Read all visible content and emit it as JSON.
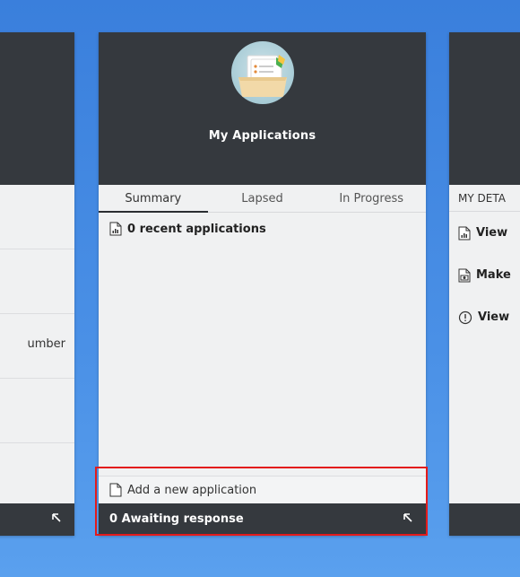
{
  "left_card": {
    "row_text": "umber"
  },
  "center_card": {
    "title": "My Applications",
    "tabs": [
      {
        "label": "Summary",
        "active": true
      },
      {
        "label": "Lapsed",
        "active": false
      },
      {
        "label": "In Progress",
        "active": false
      }
    ],
    "summary_text": "0 recent applications",
    "add_action": "Add a new application",
    "footer_status": "0 Awaiting response",
    "icons": {
      "logo": "application-folder-icon",
      "summary": "report-chart-icon",
      "add": "document-icon",
      "footer": "expand-arrow-icon"
    }
  },
  "right_card": {
    "heading": "MY DETA",
    "items": [
      {
        "label": "View",
        "icon": "report-chart-icon"
      },
      {
        "label": "Make",
        "icon": "document-camera-icon"
      },
      {
        "label": "View",
        "icon": "alert-circle-icon"
      }
    ]
  },
  "colors": {
    "card_header": "#35393e",
    "card_body": "#f0f1f2",
    "highlight": "#e31b1b",
    "background": "#4a90e6"
  }
}
